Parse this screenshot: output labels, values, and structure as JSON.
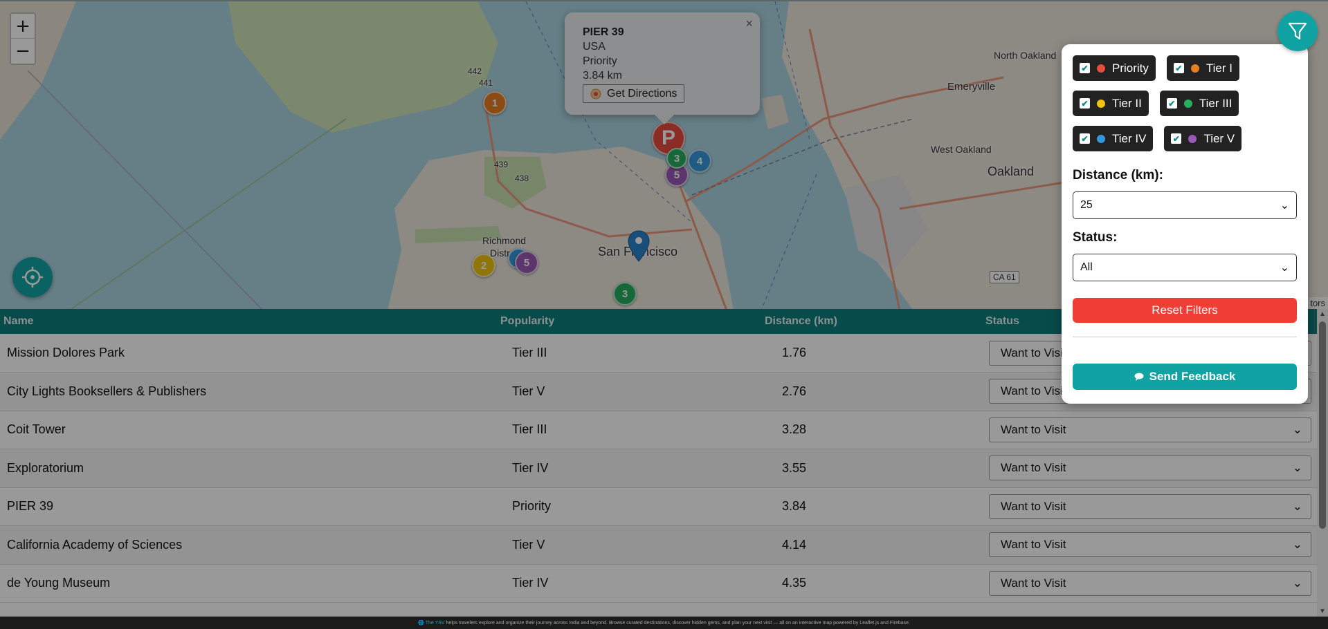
{
  "map": {
    "zoom_in": "+",
    "zoom_out": "−",
    "labels": {
      "san_francisco": "San Francisco",
      "richmond": "Richmond",
      "richmond_district": "Distr",
      "oakland": "Oakland",
      "west_oakland": "West Oakland",
      "emeryville": "Emeryville",
      "north_oakland": "North Oakland",
      "road_442": "442",
      "road_441": "441",
      "road_439": "439",
      "road_438": "438",
      "ca61": "CA 61"
    },
    "markers": [
      "1",
      "2",
      "3",
      "4",
      "5",
      "P",
      "3",
      "3",
      "2",
      "5"
    ],
    "attribution": "tors"
  },
  "popup": {
    "title": "PIER 39",
    "country": "USA",
    "category": "Priority",
    "distance": "3.84 km",
    "directions_label": "Get Directions"
  },
  "filters": {
    "chips": [
      {
        "label": "Priority",
        "color": "#e74c3c"
      },
      {
        "label": "Tier I",
        "color": "#e67e22"
      },
      {
        "label": "Tier II",
        "color": "#f1c40f"
      },
      {
        "label": "Tier III",
        "color": "#27ae60"
      },
      {
        "label": "Tier IV",
        "color": "#3498db"
      },
      {
        "label": "Tier V",
        "color": "#9b59b6"
      }
    ],
    "distance_label": "Distance (km):",
    "distance_value": "25",
    "status_label": "Status:",
    "status_value": "All",
    "reset_label": "Reset Filters",
    "feedback_label": "Send Feedback"
  },
  "table": {
    "headers": [
      "Name",
      "Popularity",
      "Distance (km)",
      "Status"
    ],
    "rows": [
      {
        "name": "Mission Dolores Park",
        "popularity": "Tier III",
        "distance": "1.76",
        "status": "Want to Visit"
      },
      {
        "name": "City Lights Booksellers & Publishers",
        "popularity": "Tier V",
        "distance": "2.76",
        "status": "Want to Visit"
      },
      {
        "name": "Coit Tower",
        "popularity": "Tier III",
        "distance": "3.28",
        "status": "Want to Visit"
      },
      {
        "name": "Exploratorium",
        "popularity": "Tier IV",
        "distance": "3.55",
        "status": "Want to Visit"
      },
      {
        "name": "PIER 39",
        "popularity": "Priority",
        "distance": "3.84",
        "status": "Want to Visit"
      },
      {
        "name": "California Academy of Sciences",
        "popularity": "Tier V",
        "distance": "4.14",
        "status": "Want to Visit"
      },
      {
        "name": "de Young Museum",
        "popularity": "Tier IV",
        "distance": "4.35",
        "status": "Want to Visit"
      }
    ]
  },
  "footer": {
    "brand": "The YSV",
    "text": "helps travelers explore and organize their journey across India and beyond. Browse curated destinations, discover hidden gems, and plan your next visit — all on an interactive map powered by Leaflet.js and Firebase."
  }
}
